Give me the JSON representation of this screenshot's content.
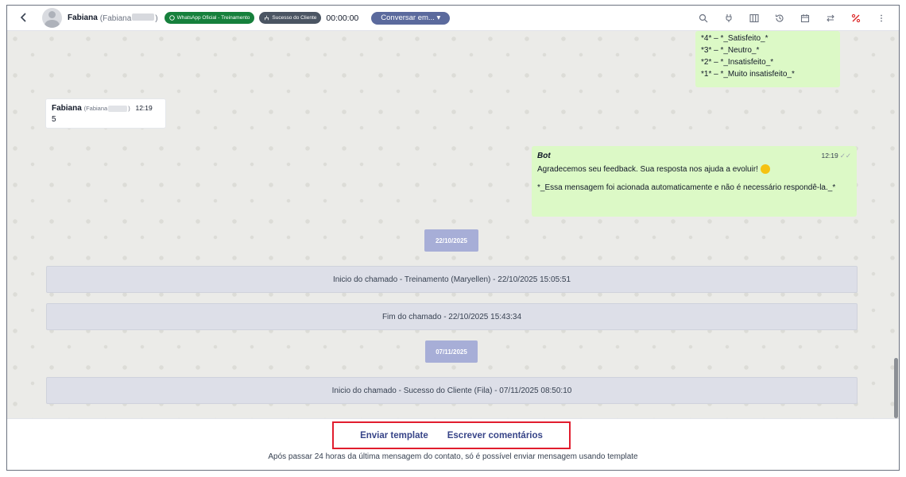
{
  "header": {
    "contact_name": "Fabiana",
    "contact_handle_open": "(Fabiana",
    "contact_handle_close": ")",
    "channel_chip": "WhatsApp Oficial - Treinamento",
    "queue_chip": "Sucesso do Cliente",
    "timer": "00:00:00",
    "talk_button": "Conversar em... ▾"
  },
  "icons": {
    "back": "chevron-left-icon",
    "search": "search-icon",
    "plug": "plug-icon",
    "columns": "columns-icon",
    "history": "history-icon",
    "calendar": "calendar-icon",
    "transfer": "transfer-icon",
    "percent": "percent-icon",
    "more": "more-vertical-icon"
  },
  "colors": {
    "channel_chip": "#16803c",
    "queue_chip": "#4b5563",
    "talk_button": "#5b6a9d",
    "outgoing_bubble": "#dcf9c6",
    "date_badge": "#a7aed7",
    "system_bar": "#dddfe8",
    "highlight_border": "#e11d2e",
    "percent_icon": "#dc2626"
  },
  "survey": {
    "lines": [
      "*4* – *_Satisfeito_*",
      "*3* – *_Neutro_*",
      "*2* – *_Insatisfeito_*",
      "*1* – *_Muito insatisfeito_*"
    ]
  },
  "incoming": {
    "name": "Fabiana",
    "handle_open": "(Fabiana",
    "handle_close": ")",
    "time": "12:19",
    "text": "5"
  },
  "bot": {
    "name": "Bot",
    "time": "12:19",
    "ticks": "✓✓",
    "line1": "Agradecemos seu feedback. Sua resposta nos ajuda a evoluir!",
    "line2": "*_Essa mensagem foi acionada automaticamente e não é necessário respondê-la._*"
  },
  "timeline": {
    "date1": "22/10/2025",
    "event1": "Inicio do chamado - Treinamento (Maryellen) - 22/10/2025 15:05:51",
    "event2": "Fim do chamado - 22/10/2025 15:43:34",
    "date2": "07/11/2025",
    "event3": "Inicio do chamado - Sucesso do Cliente (Fila) - 07/11/2025 08:50:10"
  },
  "footer": {
    "send_template": "Enviar template",
    "write_comments": "Escrever comentários",
    "notice": "Após passar 24 horas da última mensagem do contato, só é possível enviar mensagem usando template"
  }
}
